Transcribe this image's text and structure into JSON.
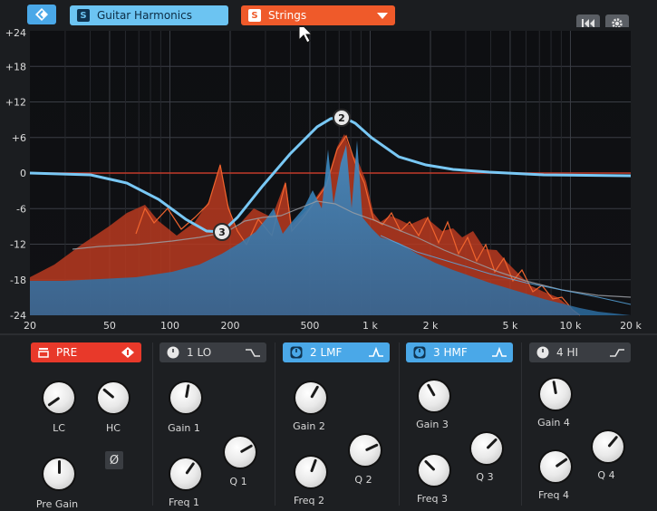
{
  "header": {
    "preset_main": "Guitar Harmonics",
    "preset_main_badge": "S",
    "preset_category": "Strings",
    "preset_category_badge": "S"
  },
  "graph": {
    "y_axis_labels": [
      "+24",
      "+18",
      "+12",
      "+6",
      "0",
      "-6",
      "-12",
      "-18",
      "-24"
    ],
    "x_axis_labels": [
      "20",
      "50",
      "100",
      "200",
      "500",
      "1 k",
      "2 k",
      "5 k",
      "10 k",
      "20 k"
    ],
    "nodes": [
      {
        "label": "3",
        "freq_hz": 175,
        "gain_db": -9.5
      },
      {
        "label": "2",
        "freq_hz": 700,
        "gain_db": 9
      }
    ]
  },
  "bands": {
    "pre": {
      "label": "PRE",
      "color": "#e8392a"
    },
    "lo": {
      "label": "1 LO"
    },
    "lmf": {
      "label": "2 LMF",
      "color": "#4aa8e8"
    },
    "hmf": {
      "label": "3 HMF",
      "color": "#4aa8e8"
    },
    "hi": {
      "label": "4 HI"
    }
  },
  "knobs": {
    "lc": "LC",
    "hc": "HC",
    "pre_gain": "Pre Gain",
    "gain1": "Gain 1",
    "freq1": "Freq 1",
    "q1": "Q 1",
    "gain2": "Gain 2",
    "freq2": "Freq 2",
    "q2": "Q 2",
    "gain3": "Gain 3",
    "freq3": "Freq 3",
    "q3": "Q 3",
    "gain4": "Gain 4",
    "freq4": "Freq 4",
    "q4": "Q 4"
  },
  "phase_symbol": "Ø",
  "colors": {
    "accent_blue": "#4aa8e8",
    "accent_orange": "#ef5a2a",
    "curve": "#79c8f5"
  }
}
